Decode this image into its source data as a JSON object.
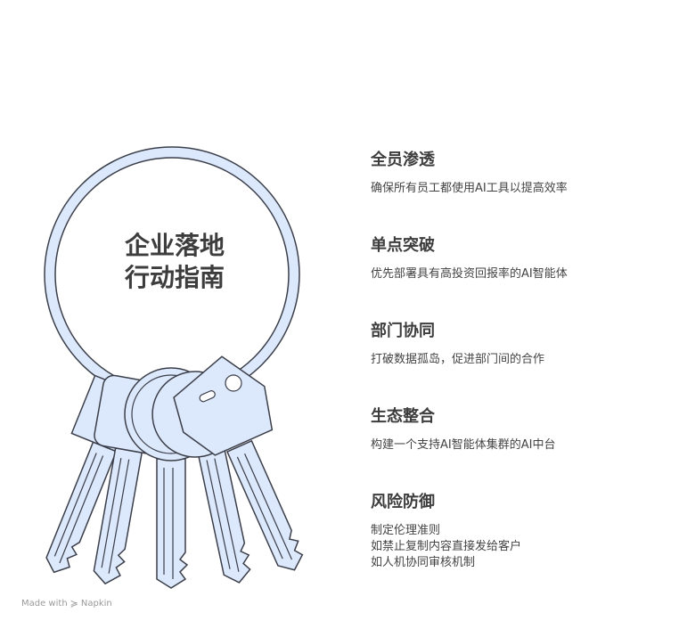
{
  "title": {
    "line1": "企业落地",
    "line2": "行动指南"
  },
  "items": [
    {
      "title": "全员渗透",
      "desc": [
        "确保所有员工都使用AI工具以提高效率"
      ]
    },
    {
      "title": "单点突破",
      "desc": [
        "优先部署具有高投资回报率的AI智能体"
      ]
    },
    {
      "title": "部门协同",
      "desc": [
        "打破数据孤岛，促进部门间的合作"
      ]
    },
    {
      "title": "生态整合",
      "desc": [
        "构建一个支持AI智能体集群的AI中台"
      ]
    },
    {
      "title": "风险防御",
      "desc": [
        "制定伦理准则",
        "如禁止复制内容直接发给客户",
        "如人机协同审核机制"
      ]
    }
  ],
  "footer": {
    "made_with": "Made with",
    "brand": "Napkin",
    "logo_icon": "napkin-logo-icon"
  },
  "colors": {
    "key_fill": "#dce8fb",
    "outline": "#3b3f4a",
    "text": "#3d3d3d",
    "footer": "#9a9a9a"
  }
}
